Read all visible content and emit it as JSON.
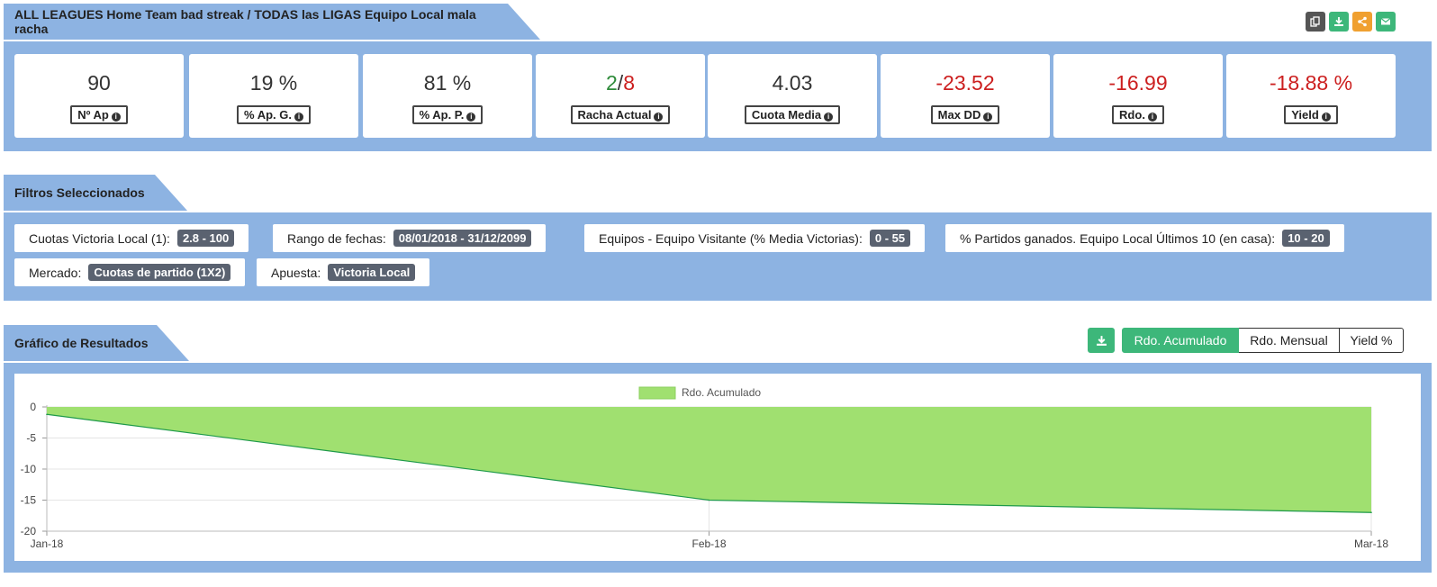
{
  "header": {
    "title": "ALL LEAGUES Home Team bad streak / TODAS las LIGAS Equipo Local mala racha",
    "buttons": [
      {
        "icon": "copy-icon",
        "color": "#555555"
      },
      {
        "icon": "download-icon",
        "color": "#3db77a"
      },
      {
        "icon": "share-icon",
        "color": "#f0a030"
      },
      {
        "icon": "email-icon",
        "color": "#3db77a"
      }
    ]
  },
  "stats": [
    {
      "value": "90",
      "label": "Nº Ap",
      "negative": false
    },
    {
      "value": "19 %",
      "label": "% Ap. G.",
      "negative": false
    },
    {
      "value": "81 %",
      "label": "% Ap. P.",
      "negative": false
    },
    {
      "value_win": "2",
      "value_sep": "/",
      "value_loss": "8",
      "label": "Racha Actual"
    },
    {
      "value": "4.03",
      "label": "Cuota Media",
      "negative": false
    },
    {
      "value": "-23.52",
      "label": "Max DD",
      "negative": true
    },
    {
      "value": "-16.99",
      "label": "Rdo.",
      "negative": true
    },
    {
      "value": "-18.88 %",
      "label": "Yield",
      "negative": true
    }
  ],
  "filters": {
    "title": "Filtros Seleccionados",
    "items": [
      {
        "label": "Cuotas Victoria Local (1):",
        "value": "2.8 - 100"
      },
      {
        "label": "Rango de fechas:",
        "value": "08/01/2018 - 31/12/2099"
      },
      {
        "label": "Equipos - Equipo Visitante (% Media Victorias):",
        "value": "0 - 55"
      },
      {
        "label": "% Partidos ganados. Equipo Local Últimos 10 (en casa):",
        "value": "10 - 20"
      },
      {
        "label": "Mercado:",
        "value": "Cuotas de partido (1X2)"
      },
      {
        "label": "Apuesta:",
        "value": "Victoria Local"
      }
    ]
  },
  "results": {
    "title": "Gráfico de Resultados",
    "buttons": {
      "acumulado": "Rdo. Acumulado",
      "mensual": "Rdo. Mensual",
      "yield": "Yield %"
    }
  },
  "chart_data": {
    "type": "area",
    "x": [
      "Jan-18",
      "Feb-18",
      "Mar-18"
    ],
    "series": [
      {
        "name": "Rdo. Acumulado",
        "values": [
          -1.2,
          -15.0,
          -16.99
        ],
        "color": "#a0e070",
        "line_color": "#1e9a4a"
      }
    ],
    "ylim": [
      -20,
      0
    ],
    "yticks": [
      0,
      -5,
      -10,
      -15,
      -20
    ],
    "legend": "top-center",
    "grid": true
  }
}
